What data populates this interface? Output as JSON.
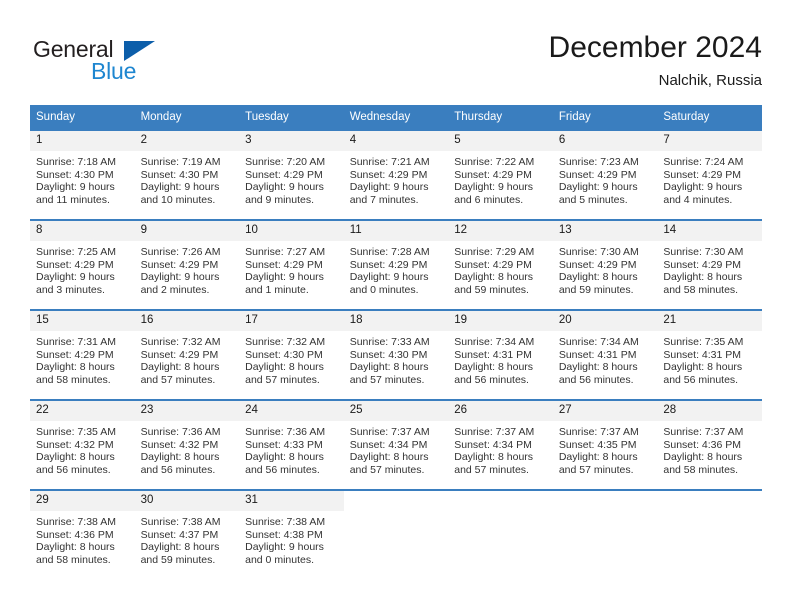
{
  "brand": {
    "name_top": "General",
    "name_bottom": "Blue",
    "triangle_color": "#0c5eaa",
    "blue_text_color": "#1e86d0"
  },
  "header": {
    "title": "December 2024",
    "subtitle": "Nalchik, Russia"
  },
  "theme": {
    "header_blue": "#3a7ebf",
    "daynum_band": "#f2f2f2",
    "text": "#333333"
  },
  "weekday_headers": [
    "Sunday",
    "Monday",
    "Tuesday",
    "Wednesday",
    "Thursday",
    "Friday",
    "Saturday"
  ],
  "weeks": [
    [
      {
        "day": "1",
        "sunrise": "Sunrise: 7:18 AM",
        "sunset": "Sunset: 4:30 PM",
        "daylight_1": "Daylight: 9 hours",
        "daylight_2": "and 11 minutes."
      },
      {
        "day": "2",
        "sunrise": "Sunrise: 7:19 AM",
        "sunset": "Sunset: 4:30 PM",
        "daylight_1": "Daylight: 9 hours",
        "daylight_2": "and 10 minutes."
      },
      {
        "day": "3",
        "sunrise": "Sunrise: 7:20 AM",
        "sunset": "Sunset: 4:29 PM",
        "daylight_1": "Daylight: 9 hours",
        "daylight_2": "and 9 minutes."
      },
      {
        "day": "4",
        "sunrise": "Sunrise: 7:21 AM",
        "sunset": "Sunset: 4:29 PM",
        "daylight_1": "Daylight: 9 hours",
        "daylight_2": "and 7 minutes."
      },
      {
        "day": "5",
        "sunrise": "Sunrise: 7:22 AM",
        "sunset": "Sunset: 4:29 PM",
        "daylight_1": "Daylight: 9 hours",
        "daylight_2": "and 6 minutes."
      },
      {
        "day": "6",
        "sunrise": "Sunrise: 7:23 AM",
        "sunset": "Sunset: 4:29 PM",
        "daylight_1": "Daylight: 9 hours",
        "daylight_2": "and 5 minutes."
      },
      {
        "day": "7",
        "sunrise": "Sunrise: 7:24 AM",
        "sunset": "Sunset: 4:29 PM",
        "daylight_1": "Daylight: 9 hours",
        "daylight_2": "and 4 minutes."
      }
    ],
    [
      {
        "day": "8",
        "sunrise": "Sunrise: 7:25 AM",
        "sunset": "Sunset: 4:29 PM",
        "daylight_1": "Daylight: 9 hours",
        "daylight_2": "and 3 minutes."
      },
      {
        "day": "9",
        "sunrise": "Sunrise: 7:26 AM",
        "sunset": "Sunset: 4:29 PM",
        "daylight_1": "Daylight: 9 hours",
        "daylight_2": "and 2 minutes."
      },
      {
        "day": "10",
        "sunrise": "Sunrise: 7:27 AM",
        "sunset": "Sunset: 4:29 PM",
        "daylight_1": "Daylight: 9 hours",
        "daylight_2": "and 1 minute."
      },
      {
        "day": "11",
        "sunrise": "Sunrise: 7:28 AM",
        "sunset": "Sunset: 4:29 PM",
        "daylight_1": "Daylight: 9 hours",
        "daylight_2": "and 0 minutes."
      },
      {
        "day": "12",
        "sunrise": "Sunrise: 7:29 AM",
        "sunset": "Sunset: 4:29 PM",
        "daylight_1": "Daylight: 8 hours",
        "daylight_2": "and 59 minutes."
      },
      {
        "day": "13",
        "sunrise": "Sunrise: 7:30 AM",
        "sunset": "Sunset: 4:29 PM",
        "daylight_1": "Daylight: 8 hours",
        "daylight_2": "and 59 minutes."
      },
      {
        "day": "14",
        "sunrise": "Sunrise: 7:30 AM",
        "sunset": "Sunset: 4:29 PM",
        "daylight_1": "Daylight: 8 hours",
        "daylight_2": "and 58 minutes."
      }
    ],
    [
      {
        "day": "15",
        "sunrise": "Sunrise: 7:31 AM",
        "sunset": "Sunset: 4:29 PM",
        "daylight_1": "Daylight: 8 hours",
        "daylight_2": "and 58 minutes."
      },
      {
        "day": "16",
        "sunrise": "Sunrise: 7:32 AM",
        "sunset": "Sunset: 4:29 PM",
        "daylight_1": "Daylight: 8 hours",
        "daylight_2": "and 57 minutes."
      },
      {
        "day": "17",
        "sunrise": "Sunrise: 7:32 AM",
        "sunset": "Sunset: 4:30 PM",
        "daylight_1": "Daylight: 8 hours",
        "daylight_2": "and 57 minutes."
      },
      {
        "day": "18",
        "sunrise": "Sunrise: 7:33 AM",
        "sunset": "Sunset: 4:30 PM",
        "daylight_1": "Daylight: 8 hours",
        "daylight_2": "and 57 minutes."
      },
      {
        "day": "19",
        "sunrise": "Sunrise: 7:34 AM",
        "sunset": "Sunset: 4:31 PM",
        "daylight_1": "Daylight: 8 hours",
        "daylight_2": "and 56 minutes."
      },
      {
        "day": "20",
        "sunrise": "Sunrise: 7:34 AM",
        "sunset": "Sunset: 4:31 PM",
        "daylight_1": "Daylight: 8 hours",
        "daylight_2": "and 56 minutes."
      },
      {
        "day": "21",
        "sunrise": "Sunrise: 7:35 AM",
        "sunset": "Sunset: 4:31 PM",
        "daylight_1": "Daylight: 8 hours",
        "daylight_2": "and 56 minutes."
      }
    ],
    [
      {
        "day": "22",
        "sunrise": "Sunrise: 7:35 AM",
        "sunset": "Sunset: 4:32 PM",
        "daylight_1": "Daylight: 8 hours",
        "daylight_2": "and 56 minutes."
      },
      {
        "day": "23",
        "sunrise": "Sunrise: 7:36 AM",
        "sunset": "Sunset: 4:32 PM",
        "daylight_1": "Daylight: 8 hours",
        "daylight_2": "and 56 minutes."
      },
      {
        "day": "24",
        "sunrise": "Sunrise: 7:36 AM",
        "sunset": "Sunset: 4:33 PM",
        "daylight_1": "Daylight: 8 hours",
        "daylight_2": "and 56 minutes."
      },
      {
        "day": "25",
        "sunrise": "Sunrise: 7:37 AM",
        "sunset": "Sunset: 4:34 PM",
        "daylight_1": "Daylight: 8 hours",
        "daylight_2": "and 57 minutes."
      },
      {
        "day": "26",
        "sunrise": "Sunrise: 7:37 AM",
        "sunset": "Sunset: 4:34 PM",
        "daylight_1": "Daylight: 8 hours",
        "daylight_2": "and 57 minutes."
      },
      {
        "day": "27",
        "sunrise": "Sunrise: 7:37 AM",
        "sunset": "Sunset: 4:35 PM",
        "daylight_1": "Daylight: 8 hours",
        "daylight_2": "and 57 minutes."
      },
      {
        "day": "28",
        "sunrise": "Sunrise: 7:37 AM",
        "sunset": "Sunset: 4:36 PM",
        "daylight_1": "Daylight: 8 hours",
        "daylight_2": "and 58 minutes."
      }
    ],
    [
      {
        "day": "29",
        "sunrise": "Sunrise: 7:38 AM",
        "sunset": "Sunset: 4:36 PM",
        "daylight_1": "Daylight: 8 hours",
        "daylight_2": "and 58 minutes."
      },
      {
        "day": "30",
        "sunrise": "Sunrise: 7:38 AM",
        "sunset": "Sunset: 4:37 PM",
        "daylight_1": "Daylight: 8 hours",
        "daylight_2": "and 59 minutes."
      },
      {
        "day": "31",
        "sunrise": "Sunrise: 7:38 AM",
        "sunset": "Sunset: 4:38 PM",
        "daylight_1": "Daylight: 9 hours",
        "daylight_2": "and 0 minutes."
      },
      {
        "day": "",
        "sunrise": "",
        "sunset": "",
        "daylight_1": "",
        "daylight_2": ""
      },
      {
        "day": "",
        "sunrise": "",
        "sunset": "",
        "daylight_1": "",
        "daylight_2": ""
      },
      {
        "day": "",
        "sunrise": "",
        "sunset": "",
        "daylight_1": "",
        "daylight_2": ""
      },
      {
        "day": "",
        "sunrise": "",
        "sunset": "",
        "daylight_1": "",
        "daylight_2": ""
      }
    ]
  ]
}
